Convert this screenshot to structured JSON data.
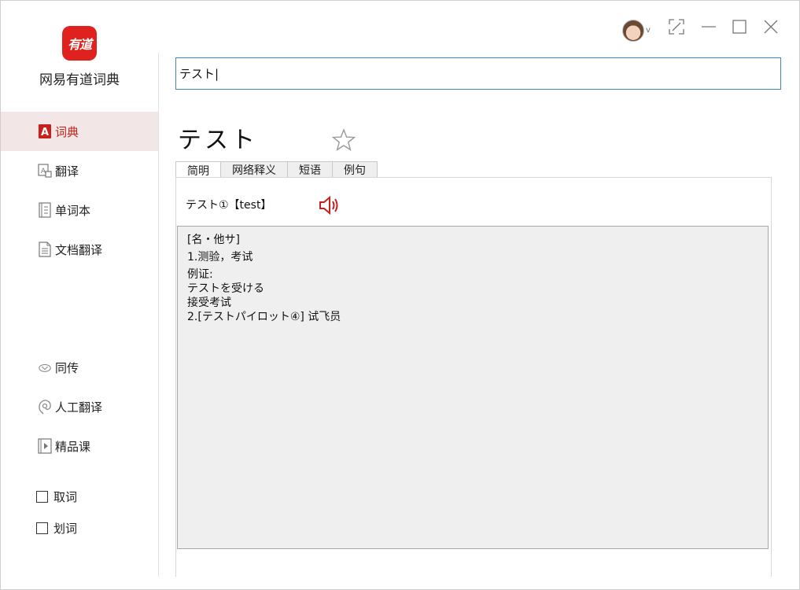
{
  "app": {
    "name": "网易有道词典",
    "logo_text": "有道"
  },
  "sidebar": {
    "items": [
      {
        "label": "词典",
        "icon": "dictionary-icon",
        "active": true
      },
      {
        "label": "翻译",
        "icon": "translate-icon",
        "active": false
      },
      {
        "label": "单词本",
        "icon": "wordbook-icon",
        "active": false
      },
      {
        "label": "文档翻译",
        "icon": "document-icon",
        "active": false
      },
      {
        "label": "同传",
        "icon": "simultaneous-icon",
        "active": false
      },
      {
        "label": "人工翻译",
        "icon": "human-translation-icon",
        "active": false
      },
      {
        "label": "精品课",
        "icon": "course-icon",
        "active": false
      }
    ],
    "checks": [
      {
        "label": "取词",
        "checked": false
      },
      {
        "label": "划词",
        "checked": false
      }
    ]
  },
  "titlebar": {
    "avatar_caret": "v"
  },
  "search": {
    "value": "テスト|"
  },
  "entry": {
    "headword": "テスト",
    "tabs": [
      "简明",
      "网络释义",
      "短语",
      "例句"
    ],
    "active_tab": "简明",
    "pronunciation": "テスト①【test】",
    "definition_lines": [
      "[名・他サ]",
      "1.测验，考试",
      "例证:",
      "テストを受ける",
      "接受考试",
      "2.[テストパイロット④] 试飞员"
    ]
  },
  "colors": {
    "accent_red": "#c8201b",
    "logo_red": "#e0221e",
    "input_border": "#3d86c6",
    "active_nav_bg": "#f2e6e6"
  }
}
